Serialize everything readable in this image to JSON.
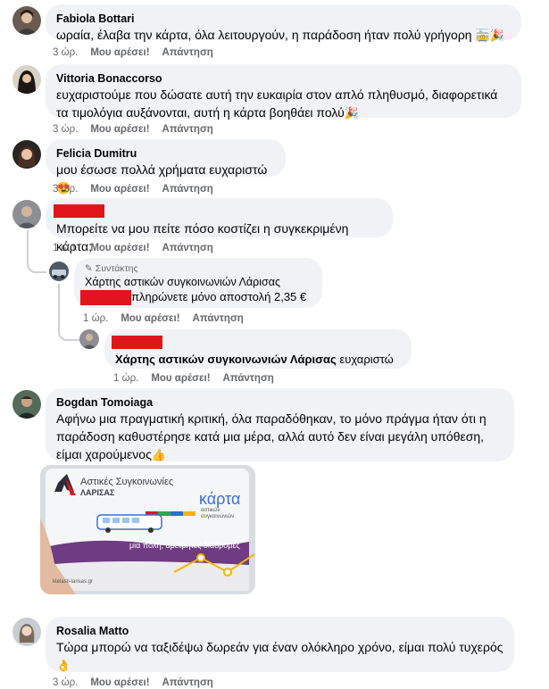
{
  "actions": {
    "like": "Μου αρέσει!",
    "reply": "Απάντηση"
  },
  "comments": [
    {
      "name": "Fabiola Bottari",
      "text": "ωραία, έλαβα την κάρτα, όλα λειτουργούν, η παράδοση ήταν πολύ γρήγορη",
      "emoji": "🚋🎉",
      "time": "3 ώρ."
    },
    {
      "name": "Vittoria Bonaccorso",
      "text": "ευχαριστούμε που δώσατε αυτή την ευκαιρία στον απλό πληθυσμό, διαφορετικά τα τιμολόγια αυξάνονται, αυτή η κάρτα βοηθάει πολύ",
      "emoji": "🎉",
      "time": "3 ώρ."
    },
    {
      "name": "Felicia Dumitru",
      "text": "μου έσωσε πολλά χρήματα ευχαριστώ",
      "emoji": "😍",
      "time": "3 ώρ."
    },
    {
      "name": "",
      "text": "Μπορείτε να μου πείτε πόσο κοστίζει η συγκεκριμένη κάρτα;",
      "time": "1 ώρ."
    },
    {
      "badge": "Συντάκτης",
      "name": "Χάρτης αστικών συγκοινωνιών Λάρισας",
      "text": "πληρώνετε μόνο αποστολή 2,35 €",
      "time": "1 ώρ."
    },
    {
      "mention": "Χάρτης αστικών συγκοινωνιών Λάρισας",
      "text": " ευχαριστώ",
      "time": "1 ώρ."
    },
    {
      "name": "Bogdan Tomoiaga",
      "text": "Αφήνω μια πραγματική κριτική, όλα παραδόθηκαν, το μόνο πράγμα ήταν ότι η παράδοση καθυστέρησε κατά μια μέρα, αλλά αυτό δεν είναι μεγάλη υπόθεση, είμαι χαρούμενος",
      "emoji": "👍",
      "time": "3 ώρ."
    },
    {
      "name": "Rosalia Matto",
      "text": "Τώρα μπορώ να ταξιδέψω δωρεάν για έναν ολόκληρο χρόνο, είμαι πολύ τυχερός",
      "emoji": "👌",
      "time": "3 ώρ."
    }
  ],
  "card": {
    "brand_line1": "Αστικές",
    "brand_line2": "Συγκοινωνίες",
    "city": "ΛΑΡΙΣΑΣ",
    "title": "κάρτα",
    "subtitle": "αστικών συγκοινωνιών",
    "slogan": "μια πόλη, αμέτρητες διαδρομές",
    "url": "ktelasti-larisas.gr"
  }
}
